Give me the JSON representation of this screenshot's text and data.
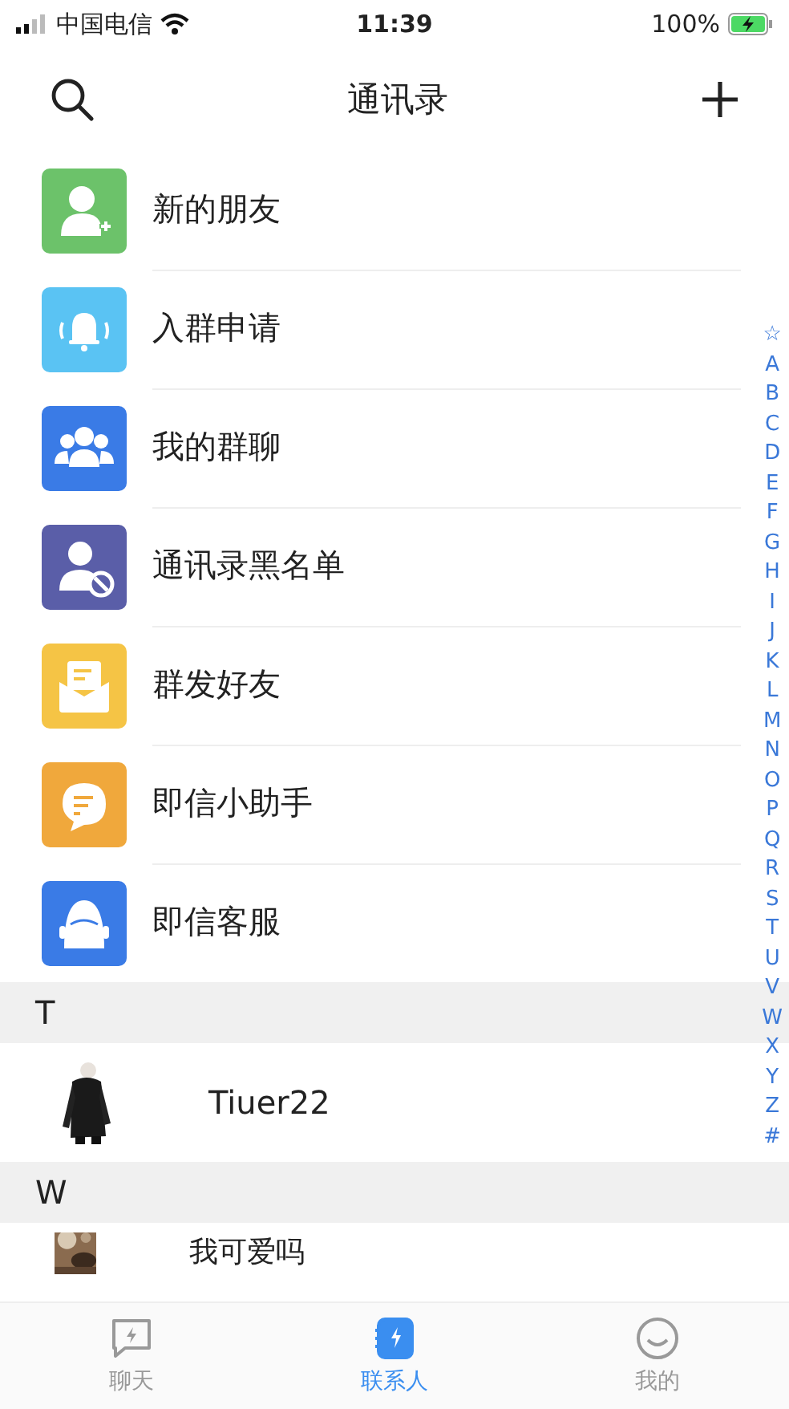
{
  "status_bar": {
    "carrier": "中国电信",
    "time": "11:39",
    "battery": "100%"
  },
  "header": {
    "title": "通讯录"
  },
  "menu_items": [
    {
      "label": "新的朋友"
    },
    {
      "label": "入群申请"
    },
    {
      "label": "我的群聊"
    },
    {
      "label": "通讯录黑名单"
    },
    {
      "label": "群发好友"
    },
    {
      "label": "即信小助手"
    },
    {
      "label": "即信客服"
    }
  ],
  "sections": [
    {
      "letter": "T",
      "contacts": [
        {
          "name": "Tiuer22"
        }
      ]
    },
    {
      "letter": "W",
      "contacts": [
        {
          "name": "我可爱吗"
        }
      ]
    }
  ],
  "index_letters": [
    "☆",
    "A",
    "B",
    "C",
    "D",
    "E",
    "F",
    "G",
    "H",
    "I",
    "J",
    "K",
    "L",
    "M",
    "N",
    "O",
    "P",
    "Q",
    "R",
    "S",
    "T",
    "U",
    "V",
    "W",
    "X",
    "Y",
    "Z",
    "#"
  ],
  "tab_bar": [
    {
      "label": "聊天",
      "selected": false
    },
    {
      "label": "联系人",
      "selected": true
    },
    {
      "label": "我的",
      "selected": false
    }
  ]
}
